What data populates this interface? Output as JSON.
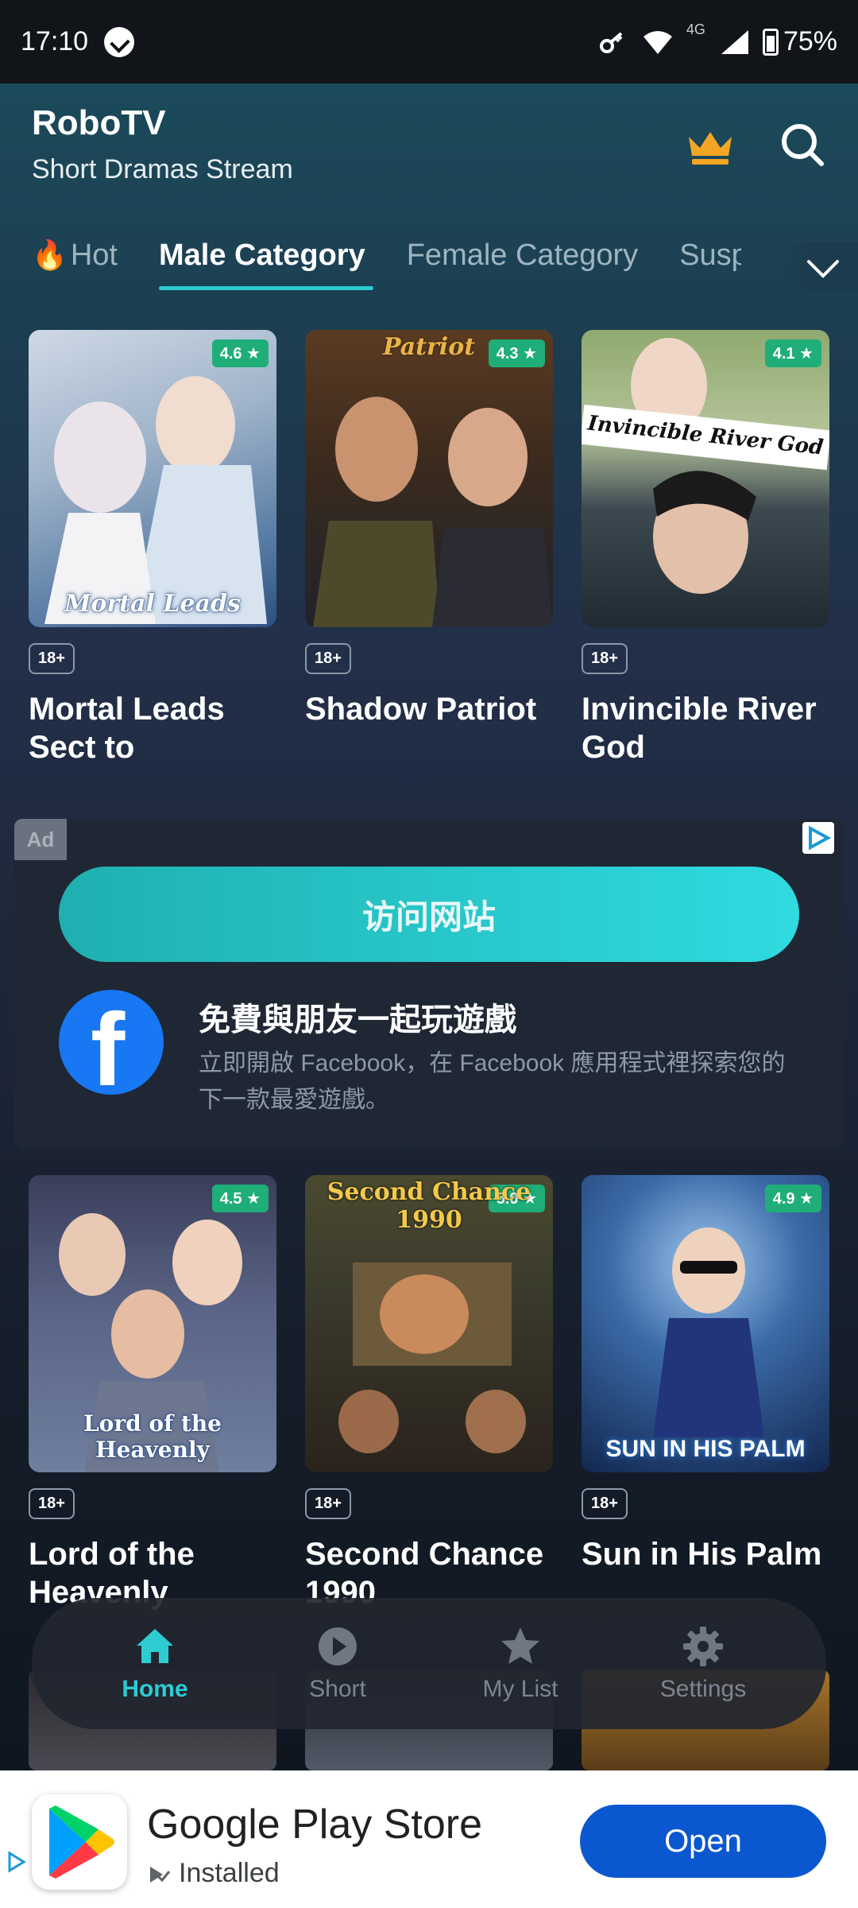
{
  "status_bar": {
    "time": "17:10",
    "network": "4G",
    "battery": "75%"
  },
  "header": {
    "title": "RoboTV",
    "subtitle": "Short Dramas Stream"
  },
  "tabs": [
    {
      "label": "Hot",
      "icon": "fire-icon"
    },
    {
      "label": "Male Category",
      "active": true
    },
    {
      "label": "Female Category"
    },
    {
      "label": "Susp"
    }
  ],
  "row1": [
    {
      "title": "Mortal Leads Sect to",
      "rating": "4.6 ★",
      "badge": "18+",
      "poster_text": "Mortal Leads"
    },
    {
      "title": "Shadow Patriot",
      "rating": "4.3 ★",
      "badge": "18+",
      "poster_text": "Patriot"
    },
    {
      "title": "Invincible River God",
      "rating": "4.1 ★",
      "badge": "18+",
      "poster_text": "Invincible River God"
    }
  ],
  "ad": {
    "label": "Ad",
    "button": "访问网站",
    "headline": "免費與朋友一起玩遊戲",
    "body": "立即開啟 Facebook，在 Facebook 應用程式裡探索您的下一款最愛遊戲。",
    "brand": "f"
  },
  "row2": [
    {
      "title": "Lord of the Heavenly",
      "rating": "4.5 ★",
      "badge": "18+",
      "poster_text": "Lord of the Heavenly"
    },
    {
      "title": "Second Chance 1990",
      "rating": "5.0 ★",
      "badge": "18+",
      "poster_text": "Second Chance 1990"
    },
    {
      "title": "Sun in His Palm",
      "rating": "4.9 ★",
      "badge": "18+",
      "poster_text": "SUN IN HIS PALM"
    }
  ],
  "nav": [
    {
      "label": "Home",
      "icon": "home-icon",
      "active": true
    },
    {
      "label": "Short",
      "icon": "play-icon"
    },
    {
      "label": "My List",
      "icon": "star-icon"
    },
    {
      "label": "Settings",
      "icon": "gear-icon"
    }
  ],
  "banner": {
    "title": "Google Play Store",
    "status": "Installed",
    "button": "Open"
  },
  "colors": {
    "accent": "#2ecbd3",
    "rating": "#1fae78",
    "open_button": "#0b57d0",
    "crown": "#f3a623"
  }
}
